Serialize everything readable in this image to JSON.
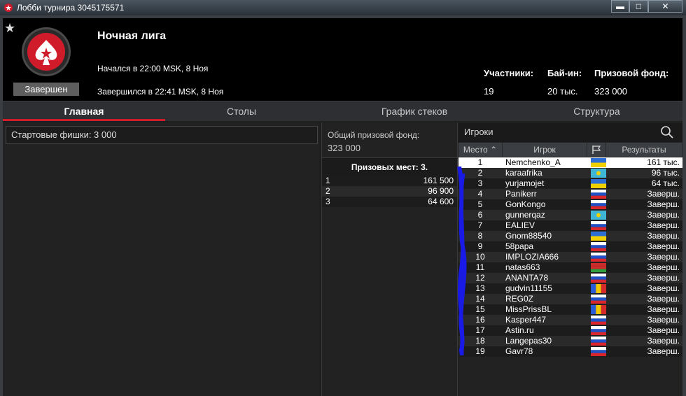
{
  "window": {
    "title": "Лобби турнира 3045175571",
    "min": "▬",
    "max": "□",
    "close": "✕"
  },
  "header": {
    "name": "Ночная лига",
    "status": "Завершен",
    "started": "Начался в 22:00 MSK, 8 Ноя",
    "ended": "Завершился в 22:41 MSK, 8 Ноя",
    "stats": [
      {
        "label": "Участники:",
        "value": "19"
      },
      {
        "label": "Бай-ин:",
        "value": "20 тыс."
      },
      {
        "label": "Призовой фонд:",
        "value": "323 000"
      }
    ]
  },
  "tabs": [
    "Главная",
    "Столы",
    "График стеков",
    "Структура"
  ],
  "main": {
    "starting_chips": "Стартовые фишки:  3 000"
  },
  "prize": {
    "pool_label": "Общий призовой фонд:",
    "pool_value": "323 000",
    "places_label": "Призовых мест: 3.",
    "places": [
      {
        "n": "1",
        "v": "161 500"
      },
      {
        "n": "2",
        "v": "96 900"
      },
      {
        "n": "3",
        "v": "64 600"
      }
    ]
  },
  "players": {
    "search_label": "Игроки",
    "columns": {
      "place": "Место",
      "player": "Игрок",
      "results": "Результаты"
    },
    "rows": [
      {
        "place": "1",
        "name": "Nemchenko_A",
        "flag": "UA",
        "result": "161 тыс."
      },
      {
        "place": "2",
        "name": "karaafrika",
        "flag": "KZ",
        "result": "96 тыс."
      },
      {
        "place": "3",
        "name": "yurjamojet",
        "flag": "UA",
        "result": "64 тыс."
      },
      {
        "place": "4",
        "name": "Panikerr",
        "flag": "RU",
        "result": "Заверш."
      },
      {
        "place": "5",
        "name": "GonKongo",
        "flag": "RU",
        "result": "Заверш."
      },
      {
        "place": "6",
        "name": "gunnerqaz",
        "flag": "KZ",
        "result": "Заверш."
      },
      {
        "place": "7",
        "name": "EALIEV",
        "flag": "RU",
        "result": "Заверш."
      },
      {
        "place": "8",
        "name": "Gnom88540",
        "flag": "UA",
        "result": "Заверш."
      },
      {
        "place": "9",
        "name": "58papa",
        "flag": "RU",
        "result": "Заверш."
      },
      {
        "place": "10",
        "name": "IMPLOZIA666",
        "flag": "RU",
        "result": "Заверш."
      },
      {
        "place": "11",
        "name": "natas663",
        "flag": "BY",
        "result": "Заверш."
      },
      {
        "place": "12",
        "name": "ANANTA78",
        "flag": "RU",
        "result": "Заверш."
      },
      {
        "place": "13",
        "name": "gudvin11155",
        "flag": "MD",
        "result": "Заверш."
      },
      {
        "place": "14",
        "name": "REG0Z",
        "flag": "RU",
        "result": "Заверш."
      },
      {
        "place": "15",
        "name": "MissPrissBL",
        "flag": "MD",
        "result": "Заверш."
      },
      {
        "place": "16",
        "name": "Kasper447",
        "flag": "RU",
        "result": "Заверш."
      },
      {
        "place": "17",
        "name": "Astin.ru",
        "flag": "RU",
        "result": "Заверш."
      },
      {
        "place": "18",
        "name": "Langepas30",
        "flag": "RU",
        "result": "Заверш."
      },
      {
        "place": "19",
        "name": "Gavr78",
        "flag": "RU",
        "result": "Заверш."
      }
    ]
  },
  "colors": {
    "accent": "#d01c2a",
    "bg": "#1e1e1e",
    "header": "#000000"
  }
}
